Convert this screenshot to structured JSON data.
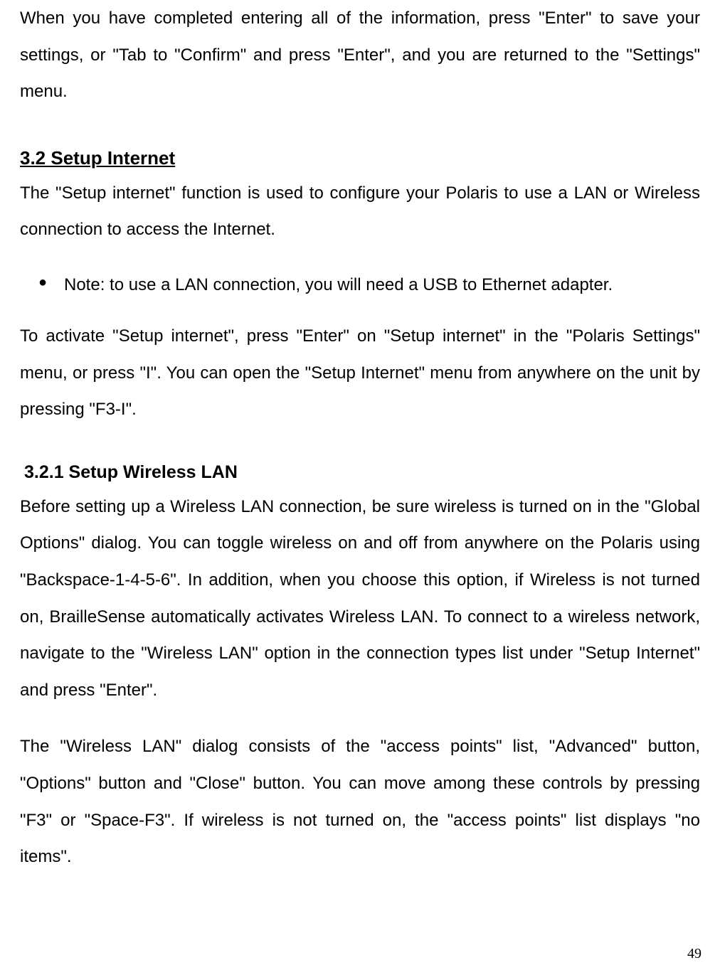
{
  "intro_para": "When you have completed entering all of the information, press \"Enter\" to save your settings, or \"Tab to \"Confirm\" and press \"Enter\", and you are returned to the \"Settings\" menu.",
  "section_3_2": {
    "heading": "3.2 Setup Internet",
    "para1": "The \"Setup internet\" function is used to configure your Polaris to use a LAN or Wireless connection to access the Internet.",
    "note": "Note: to use a LAN connection, you will need a USB to Ethernet adapter.",
    "para2": "To activate \"Setup internet\", press \"Enter\" on \"Setup internet\" in the \"Polaris Settings\" menu, or press \"I\". You can open the \"Setup Internet\" menu from anywhere on the unit by pressing \"F3-I\"."
  },
  "section_3_2_1": {
    "heading": "3.2.1 Setup Wireless LAN",
    "para1": "Before setting up a Wireless LAN connection, be sure wireless is turned on in the \"Global Options\" dialog. You can toggle wireless on and off from anywhere on the Polaris using \"Backspace-1-4-5-6\". In addition, when you choose this option, if Wireless is not turned on, BrailleSense automatically activates Wireless LAN. To connect to a wireless network, navigate to the \"Wireless LAN\" option in the connection types list under \"Setup Internet\" and press \"Enter\".",
    "para2": "The \"Wireless LAN\" dialog consists of the \"access points\" list, \"Advanced\" button, \"Options\" button and \"Close\" button. You can move among these controls by pressing \"F3\" or \"Space-F3\". If wireless is not turned on, the \"access points\" list displays \"no items\"."
  },
  "page_number": "49"
}
